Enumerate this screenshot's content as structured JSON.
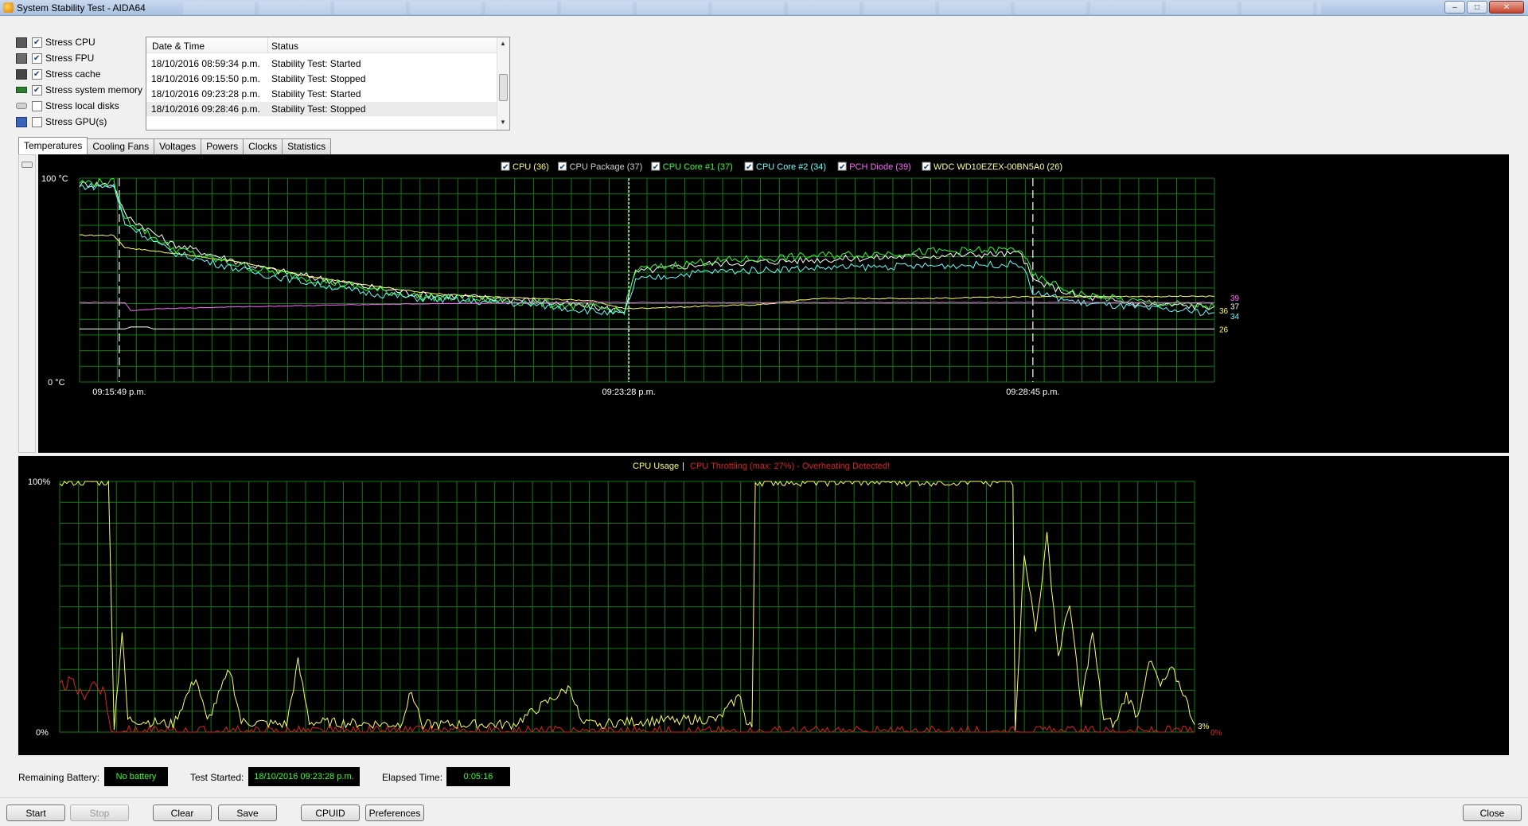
{
  "window": {
    "title": "System Stability Test - AIDA64",
    "controls": {
      "minimize": "–",
      "maximize": "□",
      "close": "✕"
    }
  },
  "stress_options": [
    {
      "label": "Stress CPU",
      "checked": true,
      "icon": "cpu-icon"
    },
    {
      "label": "Stress FPU",
      "checked": true,
      "icon": "fpu-icon"
    },
    {
      "label": "Stress cache",
      "checked": true,
      "icon": "cache-icon"
    },
    {
      "label": "Stress system memory",
      "checked": true,
      "icon": "memory-icon"
    },
    {
      "label": "Stress local disks",
      "checked": false,
      "icon": "disk-icon"
    },
    {
      "label": "Stress GPU(s)",
      "checked": false,
      "icon": "gpu-icon"
    }
  ],
  "log": {
    "columns": [
      "Date & Time",
      "Status"
    ],
    "rows": [
      {
        "time": "18/10/2016 08:59:34 p.m.",
        "status": "Stability Test: Started"
      },
      {
        "time": "18/10/2016 09:15:50 p.m.",
        "status": "Stability Test: Stopped"
      },
      {
        "time": "18/10/2016 09:23:28 p.m.",
        "status": "Stability Test: Started"
      },
      {
        "time": "18/10/2016 09:28:46 p.m.",
        "status": "Stability Test: Stopped"
      }
    ]
  },
  "tabs": [
    "Temperatures",
    "Cooling Fans",
    "Voltages",
    "Powers",
    "Clocks",
    "Statistics"
  ],
  "active_tab": "Temperatures",
  "chart_data": [
    {
      "type": "line",
      "ylabel_top": "100 °C",
      "ylabel_bottom": "0 °C",
      "ylim": [
        0,
        100
      ],
      "x_ticks": [
        "09:15:49 p.m.",
        "09:23:28 p.m.",
        "09:28:45 p.m."
      ],
      "grid": true,
      "legend_position": "top-center",
      "series": [
        {
          "name": "CPU (36)",
          "color": "#ffff66",
          "current": "36",
          "points": [
            [
              0,
              72
            ],
            [
              3,
              72
            ],
            [
              4,
              66
            ],
            [
              7,
              64
            ],
            [
              10,
              62
            ],
            [
              15,
              58
            ],
            [
              20,
              52
            ],
            [
              25,
              48
            ],
            [
              30,
              44
            ],
            [
              35,
              42
            ],
            [
              45,
              40
            ],
            [
              48,
              36
            ],
            [
              60,
              38
            ],
            [
              65,
              41
            ],
            [
              75,
              41
            ],
            [
              85,
              42
            ],
            [
              90,
              42
            ],
            [
              95,
              42
            ],
            [
              100,
              42
            ]
          ]
        },
        {
          "name": "CPU Package (37)",
          "color": "#ffffff",
          "current": "37",
          "points": [
            [
              0,
              97
            ],
            [
              3,
              97
            ],
            [
              4,
              82
            ],
            [
              8,
              68
            ],
            [
              12,
              62
            ],
            [
              16,
              56
            ],
            [
              20,
              52
            ],
            [
              25,
              47
            ],
            [
              30,
              43
            ],
            [
              40,
              40
            ],
            [
              48,
              35
            ],
            [
              49,
              54
            ],
            [
              55,
              58
            ],
            [
              65,
              60
            ],
            [
              75,
              62
            ],
            [
              83,
              63
            ],
            [
              84,
              50
            ],
            [
              88,
              42
            ],
            [
              94,
              38
            ],
            [
              100,
              37
            ]
          ]
        },
        {
          "name": "CPU Core #1 (37)",
          "color": "#33ff33",
          "current": "37",
          "points": [
            [
              0,
              98
            ],
            [
              3,
              98
            ],
            [
              4,
              80
            ],
            [
              8,
              66
            ],
            [
              12,
              60
            ],
            [
              16,
              55
            ],
            [
              20,
              51
            ],
            [
              25,
              46
            ],
            [
              30,
              42
            ],
            [
              40,
              39
            ],
            [
              48,
              35
            ],
            [
              49,
              55
            ],
            [
              55,
              59
            ],
            [
              65,
              62
            ],
            [
              75,
              64
            ],
            [
              83,
              65
            ],
            [
              84,
              52
            ],
            [
              88,
              43
            ],
            [
              94,
              39
            ],
            [
              100,
              37
            ]
          ]
        },
        {
          "name": "CPU Core #2 (34)",
          "color": "#66ffff",
          "current": "34",
          "points": [
            [
              0,
              96
            ],
            [
              3,
              96
            ],
            [
              4,
              78
            ],
            [
              8,
              64
            ],
            [
              12,
              58
            ],
            [
              16,
              53
            ],
            [
              20,
              49
            ],
            [
              25,
              44
            ],
            [
              30,
              41
            ],
            [
              40,
              38
            ],
            [
              48,
              33
            ],
            [
              49,
              50
            ],
            [
              55,
              54
            ],
            [
              65,
              56
            ],
            [
              75,
              57
            ],
            [
              83,
              58
            ],
            [
              84,
              44
            ],
            [
              88,
              39
            ],
            [
              94,
              36
            ],
            [
              100,
              34
            ]
          ]
        },
        {
          "name": "PCH Diode (39)",
          "color": "#ff66ff",
          "current": "39",
          "points": [
            [
              0,
              39
            ],
            [
              4,
              39
            ],
            [
              4.5,
              35
            ],
            [
              7,
              36
            ],
            [
              15,
              37
            ],
            [
              25,
              38
            ],
            [
              40,
              39
            ],
            [
              60,
              39
            ],
            [
              80,
              39
            ],
            [
              100,
              39
            ]
          ]
        },
        {
          "name": "WDC WD10EZEX-00BN5A0 (26)",
          "color": "#ffffff",
          "current": "26",
          "points": [
            [
              0,
              26
            ],
            [
              4,
              26
            ],
            [
              4.5,
              27
            ],
            [
              6,
              27
            ],
            [
              6.5,
              26
            ],
            [
              100,
              26
            ]
          ]
        }
      ]
    },
    {
      "type": "line",
      "title_parts": [
        "CPU Usage",
        "|",
        "CPU Throttling (max: 27%) - Overheating Detected!"
      ],
      "ylabel_top": "100%",
      "ylabel_bottom": "0%",
      "ylim": [
        0,
        100
      ],
      "grid": true,
      "series": [
        {
          "name": "CPU Usage",
          "color": "#ffff66",
          "current": "3%",
          "points": [
            [
              0,
              100
            ],
            [
              4.3,
              100
            ],
            [
              4.8,
              2
            ],
            [
              5.5,
              40
            ],
            [
              6,
              5
            ],
            [
              10,
              3
            ],
            [
              12,
              22
            ],
            [
              13,
              4
            ],
            [
              15,
              25
            ],
            [
              16,
              4
            ],
            [
              20,
              3
            ],
            [
              21,
              28
            ],
            [
              22,
              4
            ],
            [
              30,
              3
            ],
            [
              31,
              16
            ],
            [
              32,
              3
            ],
            [
              40,
              3
            ],
            [
              45,
              18
            ],
            [
              46,
              3
            ],
            [
              50,
              4
            ],
            [
              55,
              5
            ],
            [
              58,
              5
            ],
            [
              60,
              15
            ],
            [
              60.5,
              3
            ],
            [
              61,
              2
            ],
            [
              61.3,
              100
            ],
            [
              75,
              100
            ],
            [
              84,
              100
            ],
            [
              84.2,
              2
            ],
            [
              85,
              72
            ],
            [
              86,
              40
            ],
            [
              87,
              78
            ],
            [
              88,
              30
            ],
            [
              89,
              52
            ],
            [
              90,
              10
            ],
            [
              91,
              40
            ],
            [
              92,
              5
            ],
            [
              93,
              3
            ],
            [
              94,
              15
            ],
            [
              95,
              6
            ],
            [
              96,
              30
            ],
            [
              97,
              18
            ],
            [
              98,
              25
            ],
            [
              99,
              16
            ],
            [
              100,
              3
            ]
          ]
        },
        {
          "name": "CPU Throttling",
          "color": "#dd2222",
          "current": "0%",
          "points": [
            [
              0,
              18
            ],
            [
              1,
              20
            ],
            [
              2,
              14
            ],
            [
              3,
              20
            ],
            [
              4,
              16
            ],
            [
              4.5,
              0
            ],
            [
              100,
              0
            ]
          ]
        }
      ]
    }
  ],
  "info": {
    "battery_label": "Remaining Battery:",
    "battery_value": "No battery",
    "started_label": "Test Started:",
    "started_value": "18/10/2016 09:23:28 p.m.",
    "elapsed_label": "Elapsed Time:",
    "elapsed_value": "0:05:16"
  },
  "buttons": {
    "start": "Start",
    "stop": "Stop",
    "clear": "Clear",
    "save": "Save",
    "cpuid": "CPUID",
    "preferences": "Preferences",
    "close": "Close"
  }
}
